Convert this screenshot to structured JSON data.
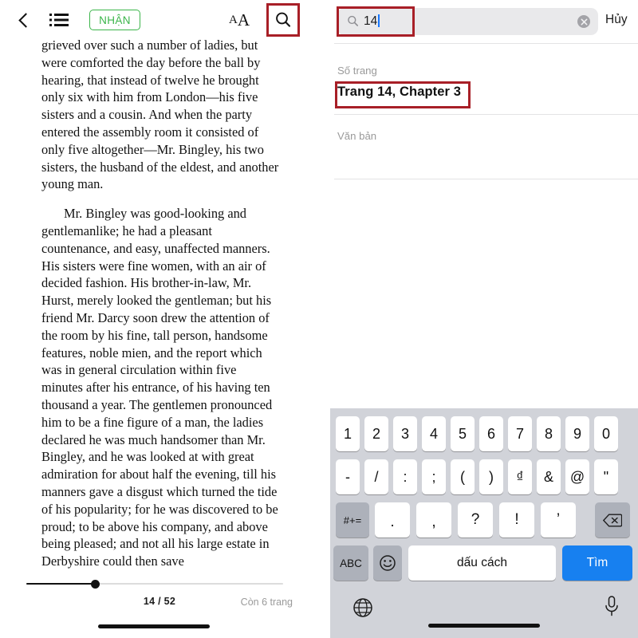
{
  "reader": {
    "toolbar": {
      "back_icon": "chevron-left-icon",
      "toc_icon": "list-bullet-icon",
      "get_label": "NHẬN",
      "get_color": "#3bb54a",
      "font_size_small": "A",
      "font_size_big": "A",
      "search_icon": "magnifier-icon",
      "highlight_color": "#a81f27"
    },
    "body": {
      "paragraph_1": "grieved over such a number of ladies, but were comforted the day before the ball by hearing, that instead of twelve he brought only six with him from London—his five sisters and a cousin. And when the party entered the assembly room it consisted of only five altogether—Mr. Bingley, his two sisters, the husband of the eldest, and another young man.",
      "paragraph_2": "Mr. Bingley was good-looking and gentlemanlike; he had a pleasant countenance, and easy, unaffected manners. His sisters were fine women, with an air of decided fashion. His brother-in-law, Mr. Hurst, merely looked the gentleman; but his friend Mr. Darcy soon drew the attention of the room by his fine, tall person, handsome features, noble mien, and the report which was in general circulation within five minutes after his entrance, of his having ten thousand a year. The gentlemen pronounced him to be a fine figure of a man, the ladies declared he was much handsomer than Mr. Bingley, and he was looked at with great admiration for about half the evening, till his manners gave a disgust which turned the tide of his popularity; for he was discovered to be proud; to be above his company, and above being pleased; and not all his large estate in Derbyshire could then save"
    },
    "footer": {
      "page_indicator": "14 / 52",
      "pages_left": "Còn 6 trang",
      "slider_percent": 27,
      "current_page": 14,
      "total_pages": 52
    }
  },
  "search": {
    "query_value": "14",
    "magnifier_icon": "search-icon",
    "clear_icon": "clear-circle-icon",
    "cancel_label": "Hủy",
    "sections": {
      "pages_header": "Số trang",
      "text_header": "Văn bản"
    },
    "page_result": "Trang 14, Chapter 3",
    "highlight_color": "#a81f27"
  },
  "keyboard": {
    "row_numbers": [
      "1",
      "2",
      "3",
      "4",
      "5",
      "6",
      "7",
      "8",
      "9",
      "0"
    ],
    "row_symbols": [
      "-",
      "/",
      ":",
      ";",
      "(",
      ")",
      "₫",
      "&",
      "@",
      "\""
    ],
    "row_punct_toggle": "#+=",
    "row_punct": [
      ".",
      ",",
      "?",
      "!",
      "’"
    ],
    "backspace_icon": "backspace-icon",
    "abc_label": "ABC",
    "emoji_icon": "emoji-smiley-icon",
    "space_label": "dấu cách",
    "search_key_label": "Tìm",
    "search_key_color": "#1780f0",
    "globe_icon": "globe-icon",
    "mic_icon": "microphone-icon"
  }
}
